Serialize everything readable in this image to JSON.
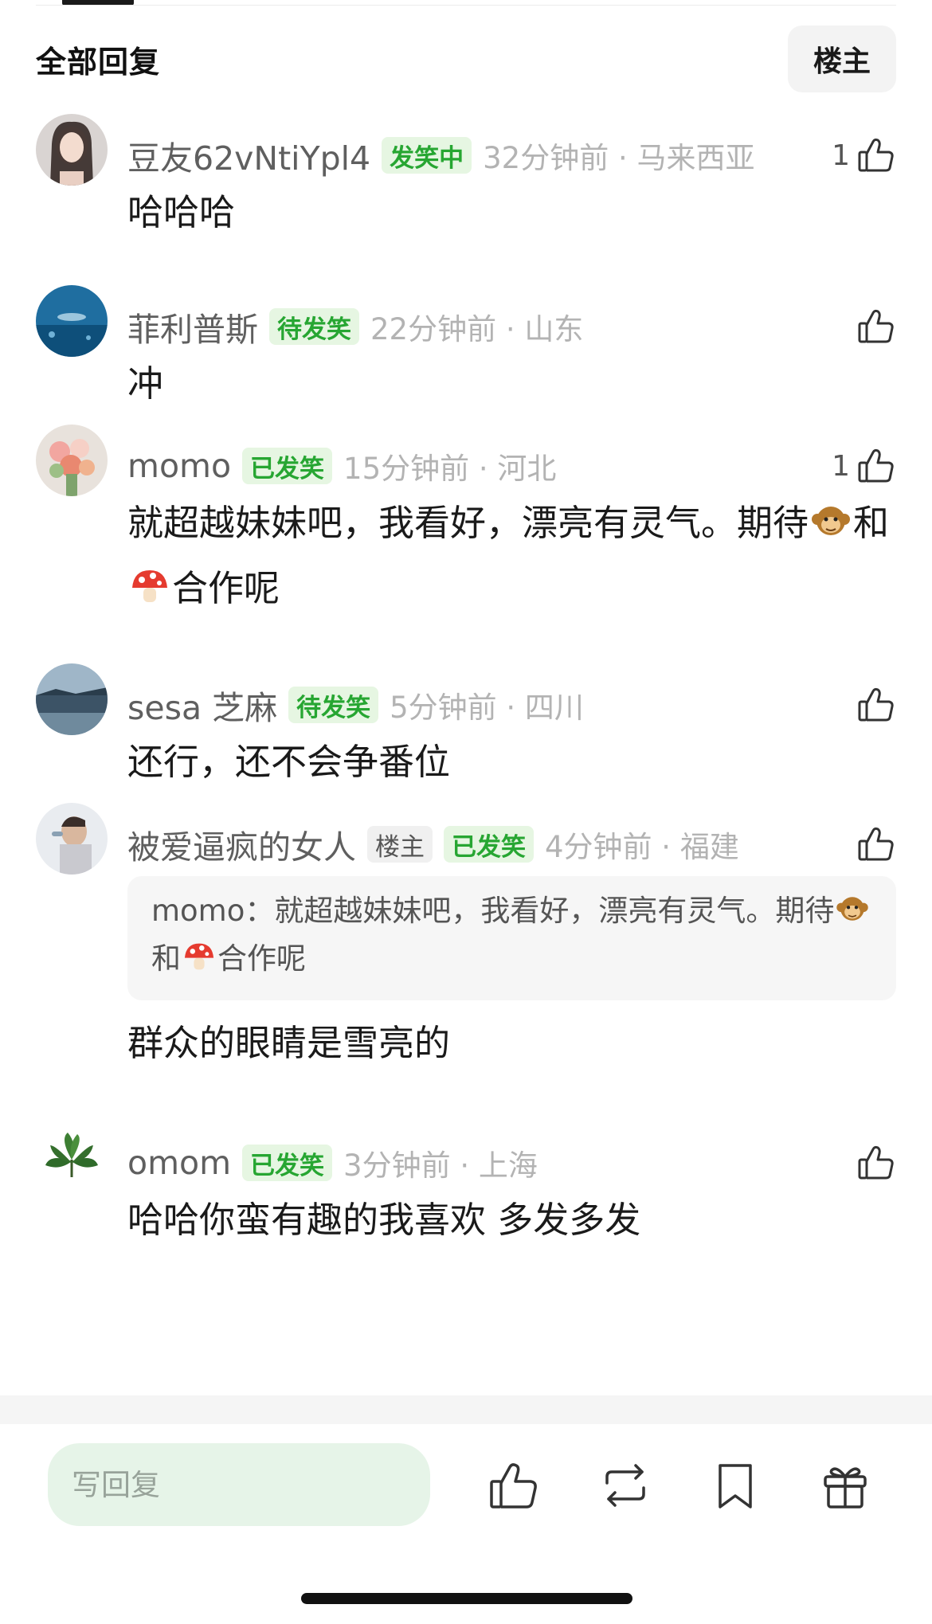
{
  "header": {
    "title": "全部回复",
    "op_filter": "楼主"
  },
  "comments": [
    {
      "user": "豆友62vNtiYpl4",
      "badges": [
        {
          "text": "发笑中",
          "style": "green"
        }
      ],
      "time": "32分钟前 · 马来西亚",
      "likes": "1",
      "text": "哈哈哈",
      "avatar": "woman-portrait"
    },
    {
      "user": "菲利普斯",
      "badges": [
        {
          "text": "待发笑",
          "style": "green"
        }
      ],
      "time": "22分钟前 · 山东",
      "likes": "",
      "text": "冲",
      "avatar": "underwater-shark"
    },
    {
      "user": "momo",
      "badges": [
        {
          "text": "已发笑",
          "style": "green"
        }
      ],
      "time": "15分钟前 · 河北",
      "likes": "1",
      "text_parts": [
        "就超越妹妹吧，我看好，漂亮有灵气。期待",
        "和",
        "合作呢"
      ],
      "emojis": [
        "monkey-emoji",
        "mushroom-emoji"
      ],
      "avatar": "flower-bouquet"
    },
    {
      "user": "sesa 芝麻",
      "badges": [
        {
          "text": "待发笑",
          "style": "green"
        }
      ],
      "time": "5分钟前 · 四川",
      "likes": "",
      "text": "还行，还不会争番位",
      "avatar": "lake-landscape"
    },
    {
      "user": "被爱逼疯的女人",
      "badges": [
        {
          "text": "楼主",
          "style": "gray"
        },
        {
          "text": "已发笑",
          "style": "green"
        }
      ],
      "time": "4分钟前 · 福建",
      "likes": "",
      "quote": {
        "name": "momo：",
        "parts": [
          "就超越妹妹吧，我看好，漂亮有灵气。期待",
          "和",
          "合作呢"
        ]
      },
      "text": "群众的眼睛是雪亮的",
      "avatar": "man-drinking"
    },
    {
      "user": "omom",
      "badges": [
        {
          "text": "已发笑",
          "style": "green"
        }
      ],
      "time": "3分钟前 · 上海",
      "likes": "",
      "text": "哈哈你蛮有趣的我喜欢 多发多发",
      "avatar": "green-plant"
    }
  ],
  "bottom_bar": {
    "reply_placeholder": "写回复",
    "icons": [
      "thumbs-up-icon",
      "repost-icon",
      "bookmark-icon",
      "gift-icon"
    ]
  },
  "colors": {
    "accent_green": "#27a632",
    "badge_green_bg": "#e6f6e2",
    "reply_input_bg": "#e6f4e8"
  }
}
